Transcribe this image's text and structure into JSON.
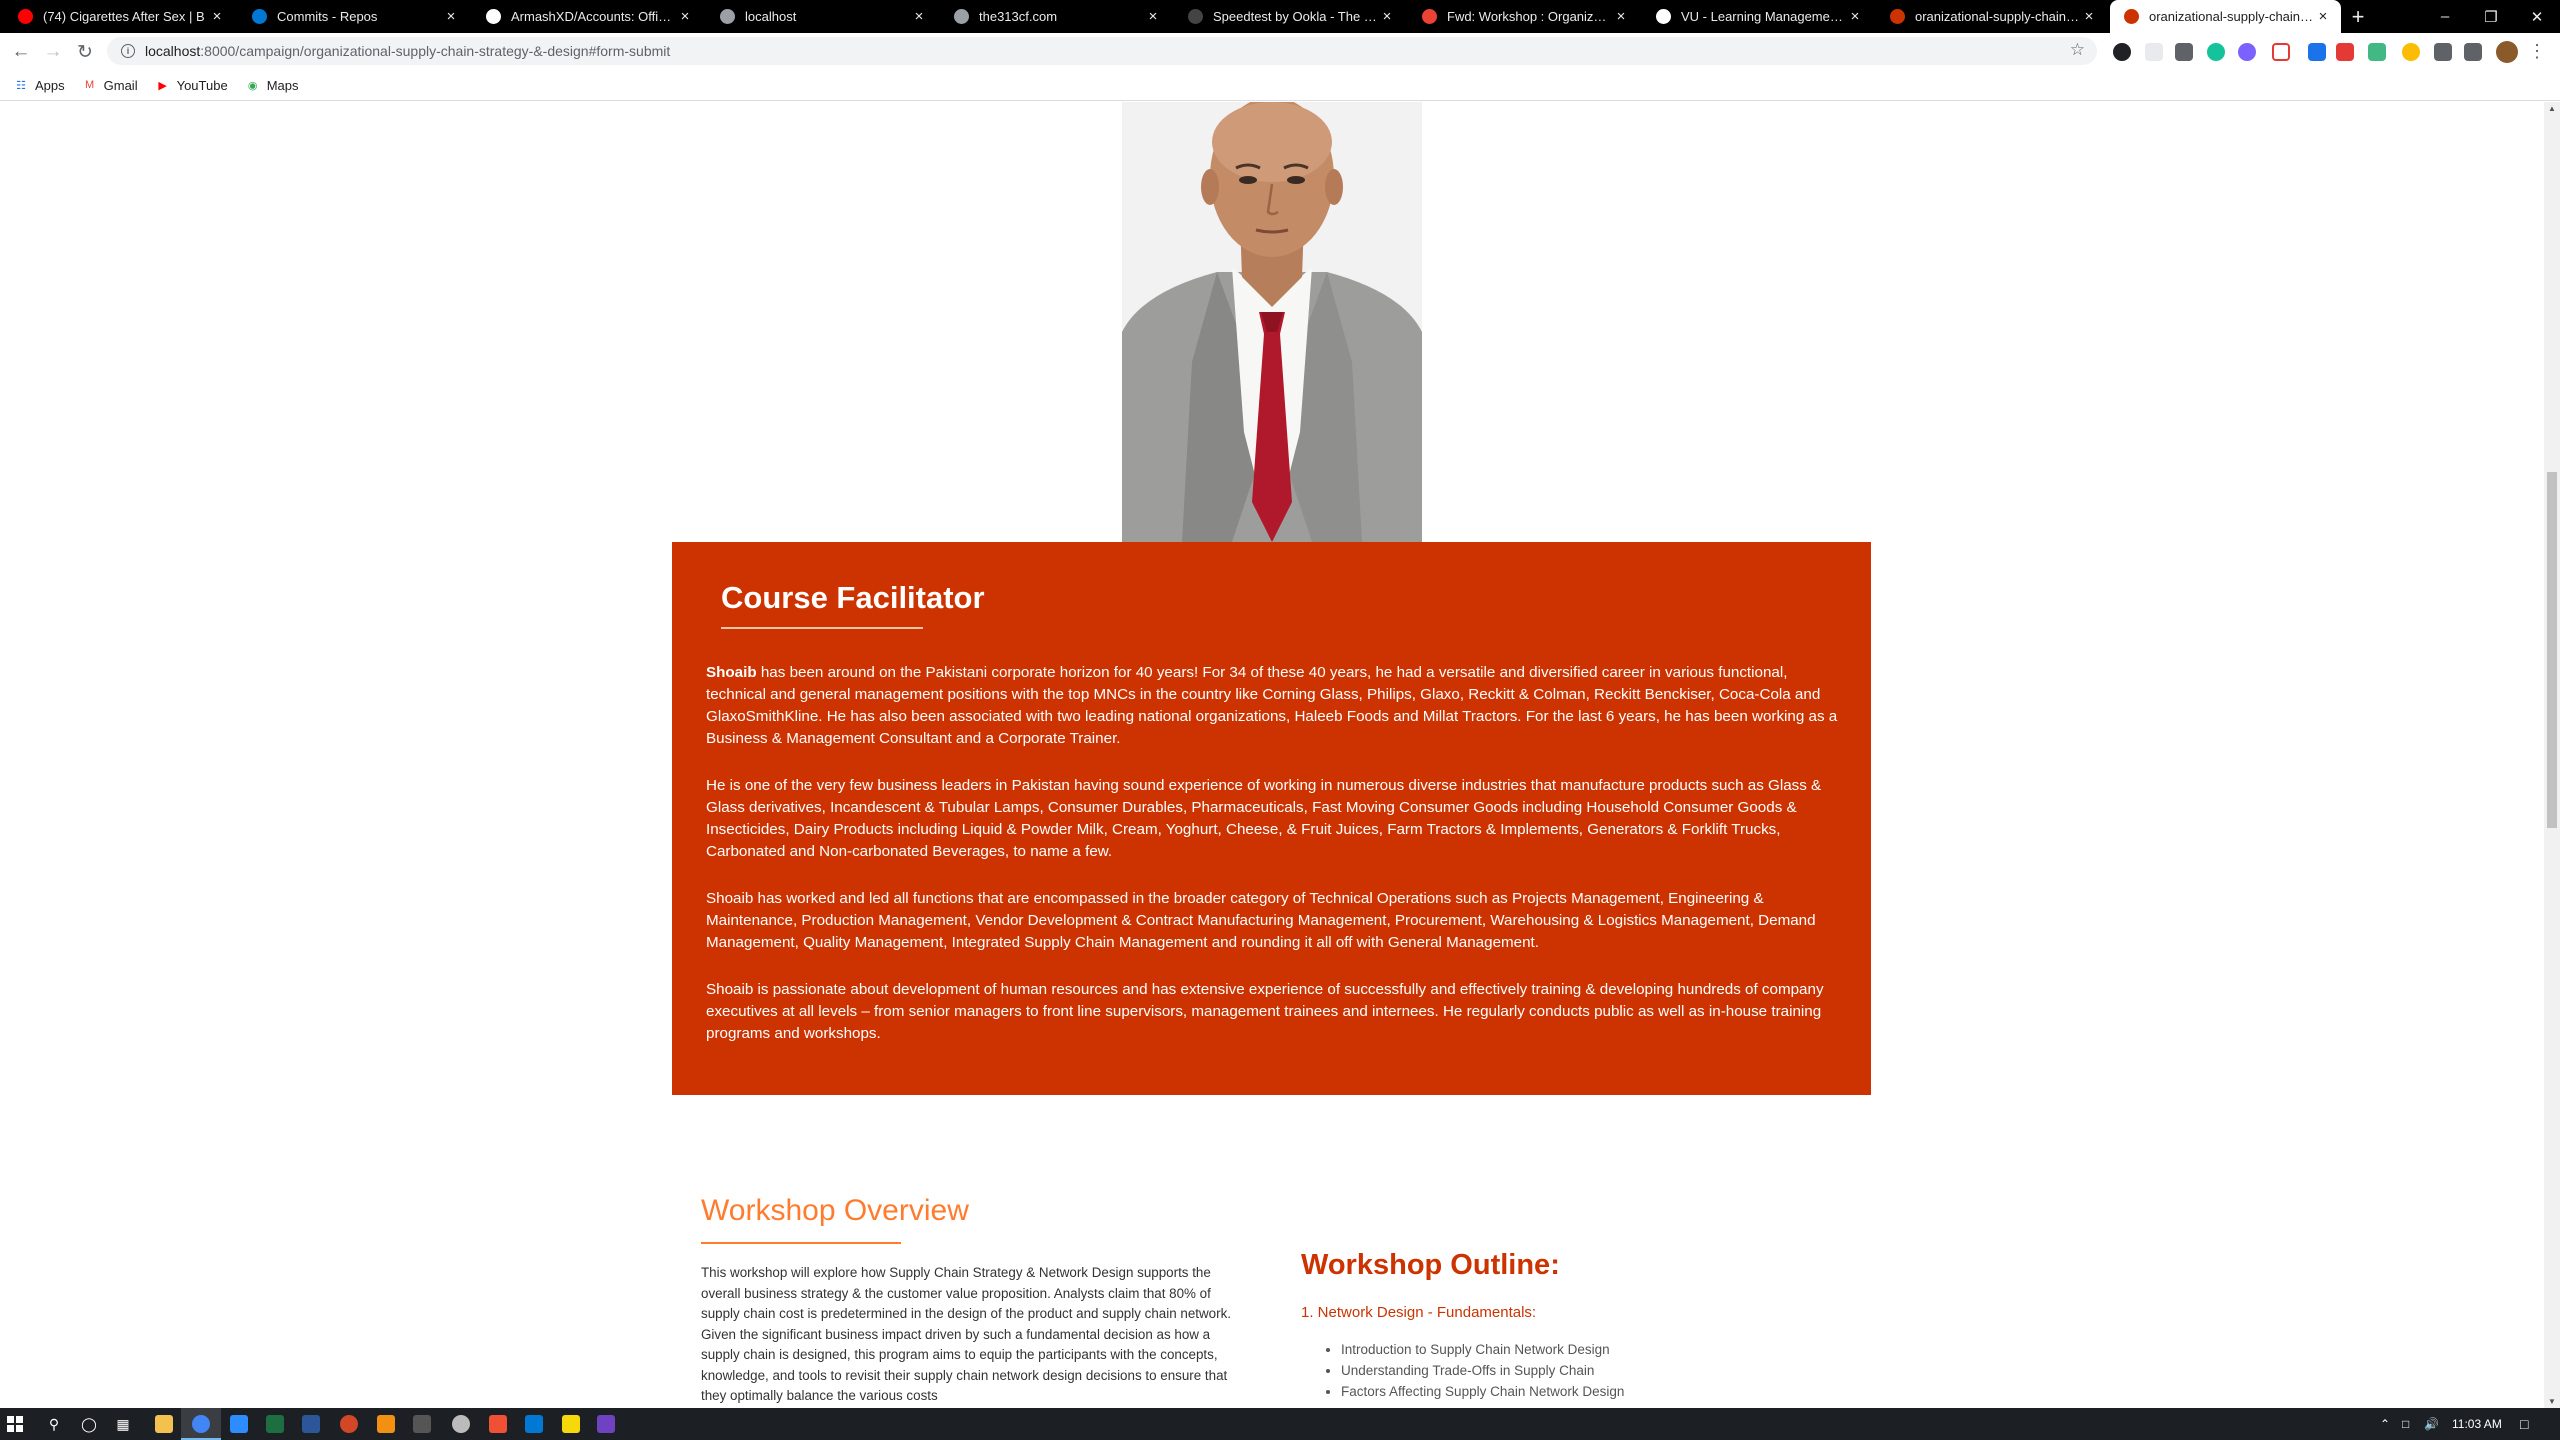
{
  "browser": {
    "tabs": [
      {
        "title": "(74) Cigarettes After Sex | B",
        "icon": "youtube-icon",
        "color": "#ff0000"
      },
      {
        "title": "Commits - Repos",
        "icon": "azure-devops-icon",
        "color": "#0078d4"
      },
      {
        "title": "ArmashXD/Accounts: Office Pr",
        "icon": "github-icon",
        "color": "#ffffff"
      },
      {
        "title": "localhost",
        "icon": "globe-icon",
        "color": "#9aa0a6"
      },
      {
        "title": "the313cf.com",
        "icon": "site-icon",
        "color": "#9aa0a6"
      },
      {
        "title": "Speedtest by Ookla - The Glob",
        "icon": "speedtest-icon",
        "color": "#444444"
      },
      {
        "title": "Fwd: Workshop : Organization",
        "icon": "gmail-icon",
        "color": "#ea4335"
      },
      {
        "title": "VU - Learning Management Sy",
        "icon": "vu-icon",
        "color": "#ffffff"
      },
      {
        "title": "oranizational-supply-chain-stra",
        "icon": "site-icon",
        "color": "#cc3300"
      },
      {
        "title": "oranizational-supply-chain-stra",
        "icon": "site-icon",
        "color": "#cc3300",
        "active": true
      }
    ],
    "url_host": "localhost",
    "url_rest": ":8000/campaign/organizational-supply-chain-strategy-&-design#form-submit",
    "bookmarks": [
      {
        "label": "Apps",
        "icon": "apps-grid-icon"
      },
      {
        "label": "Gmail",
        "icon": "gmail-icon"
      },
      {
        "label": "YouTube",
        "icon": "youtube-icon"
      },
      {
        "label": "Maps",
        "icon": "maps-pin-icon"
      }
    ]
  },
  "facilitator": {
    "title": "Course Facilitator",
    "name_bold": "Shoaib",
    "p1": " has been around on the Pakistani corporate horizon for 40 years! For 34 of these 40 years, he had a versatile and diversified career in various functional, technical and general management positions with the top MNCs in the country like Corning Glass, Philips, Glaxo, Reckitt & Colman, Reckitt Benckiser, Coca-Cola and GlaxoSmithKline. He has also been associated with two leading national organizations, Haleeb Foods and Millat Tractors. For the last 6 years, he has been working as a Business & Management Consultant and a Corporate Trainer.",
    "p2": "He is one of the very few business leaders in Pakistan having sound experience of working in numerous diverse industries that manufacture products such as Glass & Glass derivatives, Incandescent & Tubular Lamps, Consumer Durables, Pharmaceuticals, Fast Moving Consumer Goods including Household Consumer Goods & Insecticides, Dairy Products including Liquid & Powder Milk, Cream, Yoghurt, Cheese, & Fruit Juices, Farm Tractors & Implements, Generators & Forklift Trucks, Carbonated and Non-carbonated Beverages, to name a few.",
    "p3": "Shoaib has worked and led all functions that are encompassed in the broader category of Technical Operations such as Projects Management, Engineering & Maintenance, Production Management, Vendor Development & Contract Manufacturing Management, Procurement, Warehousing & Logistics Management, Demand Management, Quality Management, Integrated Supply Chain Management and rounding it all off with General Management.",
    "p4": "Shoaib is passionate about development of human resources and has extensive experience of successfully and effectively training & developing hundreds of company executives at all levels – from senior managers to front line supervisors, management trainees and internees. He regularly conducts public as well as in-house training programs and workshops."
  },
  "overview": {
    "title": "Workshop Overview",
    "body": "This workshop will explore how Supply Chain Strategy & Network Design supports the overall business strategy & the customer value proposition. Analysts claim that 80% of supply chain cost is predetermined in the design of the product and supply chain network. Given the significant business impact driven by such a fundamental decision as how a supply chain is designed, this program aims to equip the participants with the concepts, knowledge, and tools to revisit their supply chain network design decisions to ensure that they optimally balance the various costs"
  },
  "outline": {
    "title": "Workshop Outline:",
    "section1": "1. Network Design - Fundamentals:",
    "items": [
      "Introduction to Supply Chain Network Design",
      "Understanding Trade-Offs in Supply Chain",
      "Factors Affecting Supply Chain Network Design"
    ]
  },
  "taskbar": {
    "time": "11:03 AM"
  },
  "colors": {
    "brand_red": "#cc3300",
    "overview_orange": "#ff7b2e"
  }
}
